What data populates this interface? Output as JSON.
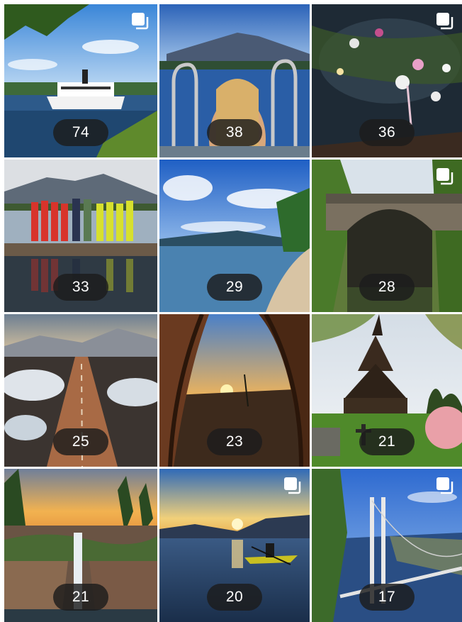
{
  "grid": {
    "tiles": [
      {
        "id": "steamboat-on-lake",
        "count": "74",
        "multi": true
      },
      {
        "id": "pool-ladder-mountain",
        "count": "38",
        "multi": false
      },
      {
        "id": "flowers-on-water",
        "count": "36",
        "multi": true
      },
      {
        "id": "group-on-dock",
        "count": "33",
        "multi": false
      },
      {
        "id": "lake-beach",
        "count": "29",
        "multi": false
      },
      {
        "id": "stone-bridge",
        "count": "28",
        "multi": true
      },
      {
        "id": "mountain-road",
        "count": "25",
        "multi": false
      },
      {
        "id": "tent-sunset",
        "count": "23",
        "multi": false
      },
      {
        "id": "stave-church",
        "count": "21",
        "multi": false
      },
      {
        "id": "waterfall-sunset",
        "count": "21",
        "multi": false
      },
      {
        "id": "kayak-sunset",
        "count": "20",
        "multi": true
      },
      {
        "id": "suspension-bridge",
        "count": "17",
        "multi": true
      }
    ]
  },
  "colors": {
    "badge_bg": "#1c1c1c",
    "badge_text": "#ffffff",
    "multi_icon": "#ffffff"
  },
  "icons": {
    "multi": "multiple-photos-icon"
  }
}
